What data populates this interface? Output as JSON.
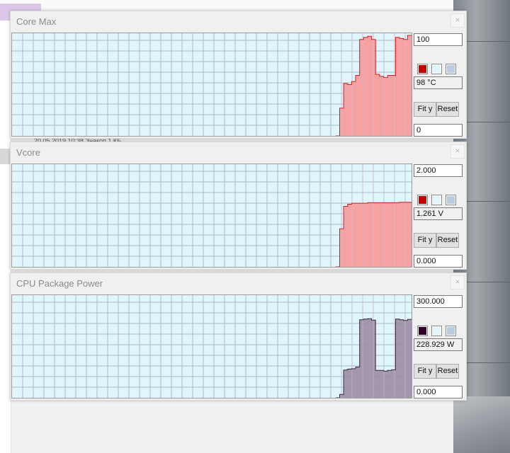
{
  "background_window": {
    "row_text": "20.05.2019 10:38          Знакоп              1 КБ"
  },
  "windows": [
    {
      "title": "Core Max",
      "max_value": "100",
      "current_value": "98 °C",
      "min_value": "0",
      "fit_label": "Fit y",
      "reset_label": "Reset",
      "close_glyph": "×",
      "line_color": "#d02020",
      "fill_color": "#f59a9a",
      "swatch_colors": [
        "#cc0000",
        "#e1f6fc",
        "#b8cce4"
      ],
      "chart_data": {
        "type": "area",
        "ylim": [
          0,
          100
        ],
        "grid": true,
        "x": [
          0,
          81,
          82,
          83,
          84,
          85,
          86,
          87,
          88,
          89,
          90,
          91,
          92,
          93,
          94,
          95,
          96,
          97,
          98,
          99,
          100
        ],
        "values": [
          0,
          0,
          27,
          51,
          50,
          53,
          59,
          94,
          96,
          97,
          94,
          60,
          58,
          57,
          59,
          59,
          96,
          95,
          94,
          98,
          98
        ]
      }
    },
    {
      "title": "Vcore",
      "max_value": "2.000",
      "current_value": "1.261 V",
      "min_value": "0.000",
      "fit_label": "Fit y",
      "reset_label": "Reset",
      "close_glyph": "×",
      "line_color": "#d02020",
      "fill_color": "#f59a9a",
      "swatch_colors": [
        "#cc0000",
        "#e1f6fc",
        "#b8cce4"
      ],
      "chart_data": {
        "type": "area",
        "ylim": [
          0,
          2
        ],
        "grid": true,
        "x": [
          0,
          81,
          82,
          83,
          84,
          85,
          89,
          93,
          97,
          100
        ],
        "values": [
          0,
          0,
          0.74,
          1.18,
          1.22,
          1.24,
          1.25,
          1.25,
          1.26,
          1.26
        ]
      }
    },
    {
      "title": "CPU Package Power",
      "max_value": "300.000",
      "current_value": "228.929 W",
      "min_value": "0.000",
      "fit_label": "Fit y",
      "reset_label": "Reset",
      "close_glyph": "×",
      "line_color": "#3a2a3a",
      "fill_color": "#9c8ea6",
      "swatch_colors": [
        "#33002a",
        "#e1f6fc",
        "#b8cce4"
      ],
      "chart_data": {
        "type": "area",
        "ylim": [
          0,
          300
        ],
        "grid": true,
        "x": [
          0,
          81,
          82,
          83,
          84,
          85,
          86,
          87,
          88,
          89,
          90,
          91,
          92,
          93,
          94,
          95,
          96,
          97,
          98,
          99,
          100
        ],
        "values": [
          0,
          0,
          10,
          81,
          84,
          85,
          90,
          228,
          230,
          231,
          227,
          80,
          80,
          78,
          80,
          82,
          230,
          228,
          226,
          229,
          229
        ]
      }
    }
  ]
}
